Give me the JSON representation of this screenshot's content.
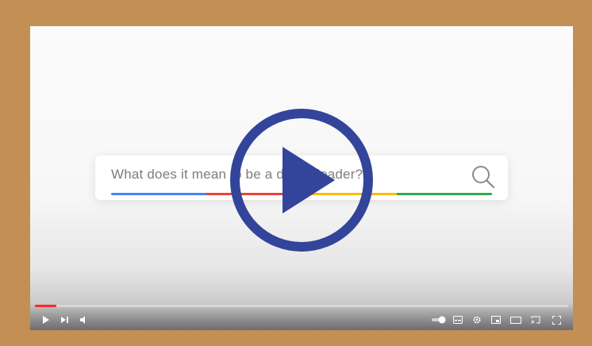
{
  "search": {
    "query": "What does it mean to be a digital leader?"
  },
  "colors": {
    "frame": "#c48f55",
    "play_ring": "#33449b",
    "progress": "#ff2a2a",
    "bar": [
      "#4285f4",
      "#ea4335",
      "#fbbc05",
      "#34a853"
    ]
  },
  "player": {
    "progress_fraction": 0.04,
    "controls_left": [
      "play-icon",
      "next-icon",
      "volume-icon"
    ],
    "controls_right": [
      "autoplay-toggle-icon",
      "subtitles-icon",
      "settings-gear-icon",
      "miniplayer-icon",
      "theater-mode-icon",
      "cast-icon",
      "fullscreen-icon"
    ]
  }
}
